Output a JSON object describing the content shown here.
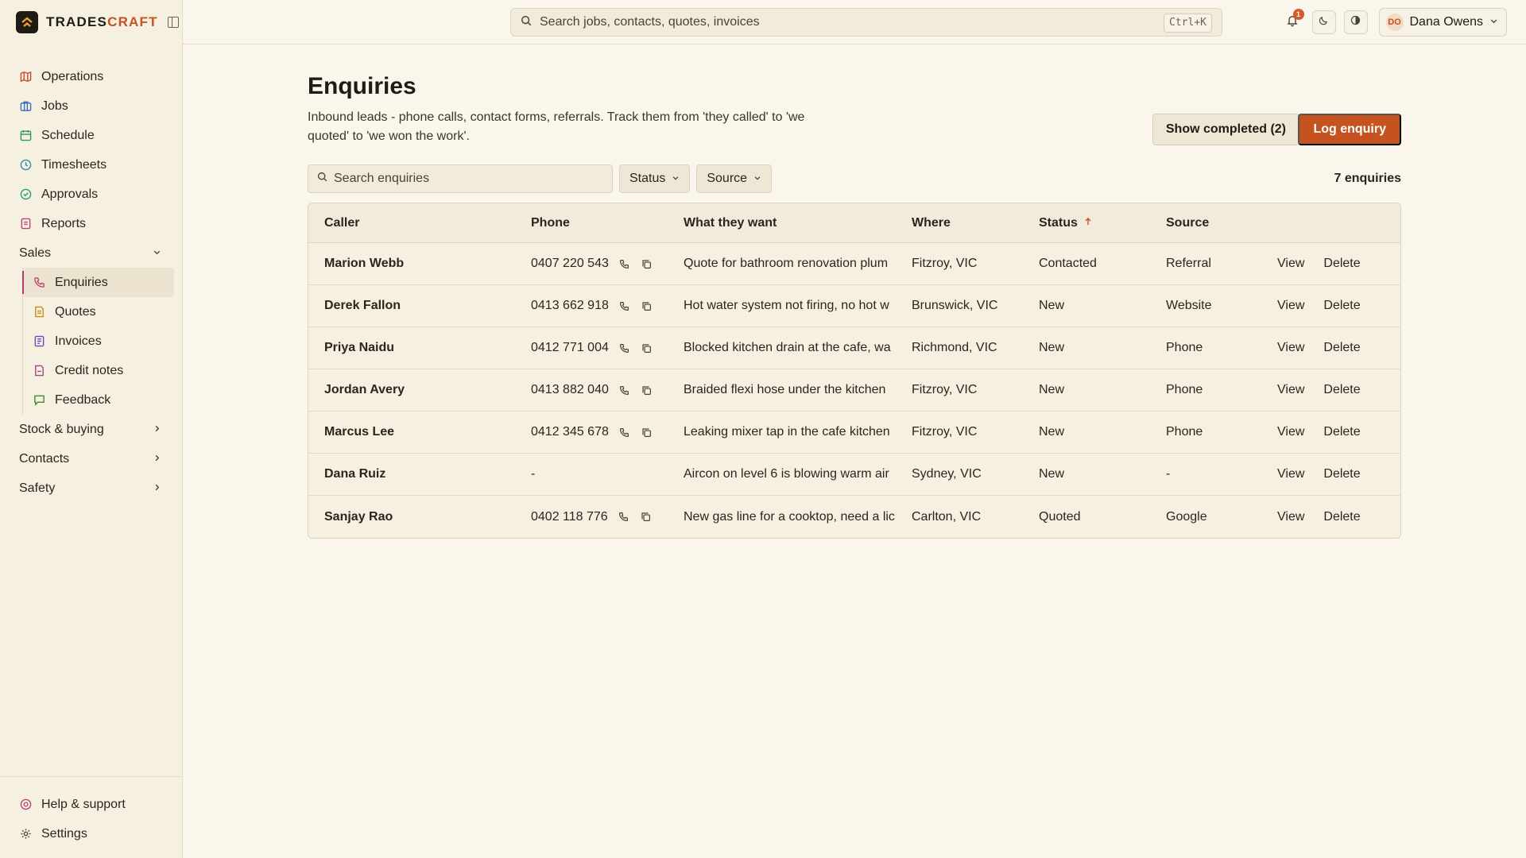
{
  "brand": {
    "name_main": "TRADES",
    "name_accent": "CRAFT"
  },
  "sidebar": {
    "items": [
      {
        "label": "Operations",
        "icon": "map-icon",
        "color": "#d0473a"
      },
      {
        "label": "Jobs",
        "icon": "briefcase-icon",
        "color": "#3b6fc4"
      },
      {
        "label": "Schedule",
        "icon": "calendar-icon",
        "color": "#2e9a52"
      },
      {
        "label": "Timesheets",
        "icon": "clock-icon",
        "color": "#2d8fa8"
      },
      {
        "label": "Approvals",
        "icon": "check-circle-icon",
        "color": "#2e9a7a"
      },
      {
        "label": "Reports",
        "icon": "report-icon",
        "color": "#b8467a"
      }
    ],
    "sales_group": "Sales",
    "sales_items": [
      {
        "label": "Enquiries",
        "icon": "phone-icon",
        "color": "#b83a6b"
      },
      {
        "label": "Quotes",
        "icon": "quote-icon",
        "color": "#c98a1a"
      },
      {
        "label": "Invoices",
        "icon": "invoice-icon",
        "color": "#6a4bc4"
      },
      {
        "label": "Credit notes",
        "icon": "credit-note-icon",
        "color": "#a0468a"
      },
      {
        "label": "Feedback",
        "icon": "message-icon",
        "color": "#3c8a3a"
      }
    ],
    "groups": [
      "Stock & buying",
      "Contacts",
      "Safety"
    ],
    "bottom": [
      {
        "label": "Help & support",
        "icon": "help-icon",
        "color": "#b8467a"
      },
      {
        "label": "Settings",
        "icon": "gear-icon",
        "color": "#4a4238"
      }
    ]
  },
  "topbar": {
    "search_placeholder": "Search jobs, contacts, quotes, invoices",
    "shortcut": "Ctrl+K",
    "notifications": "1",
    "user_initials": "DO",
    "user_name": "Dana Owens"
  },
  "page": {
    "title": "Enquiries",
    "description": "Inbound leads - phone calls, contact forms, referrals. Track them from 'they called' to 'we quoted' to 'we won the work'.",
    "show_completed": "Show completed (2)",
    "log_enquiry": "Log enquiry",
    "search_placeholder": "Search enquiries",
    "filter_status": "Status",
    "filter_source": "Source",
    "count": "7 enquiries"
  },
  "table": {
    "headers": {
      "caller": "Caller",
      "phone": "Phone",
      "want": "What they want",
      "where": "Where",
      "status": "Status",
      "source": "Source"
    },
    "view_label": "View",
    "delete_label": "Delete",
    "rows": [
      {
        "caller": "Marion Webb",
        "phone": "0407 220 543",
        "want": "Quote for bathroom renovation plum",
        "where": "Fitzroy, VIC",
        "status": "Contacted",
        "source": "Referral"
      },
      {
        "caller": "Derek Fallon",
        "phone": "0413 662 918",
        "want": "Hot water system not firing, no hot w",
        "where": "Brunswick, VIC",
        "status": "New",
        "source": "Website"
      },
      {
        "caller": "Priya Naidu",
        "phone": "0412 771 004",
        "want": "Blocked kitchen drain at the cafe, wa",
        "where": "Richmond, VIC",
        "status": "New",
        "source": "Phone"
      },
      {
        "caller": "Jordan Avery",
        "phone": "0413 882 040",
        "want": "Braided flexi hose under the kitchen",
        "where": "Fitzroy, VIC",
        "status": "New",
        "source": "Phone"
      },
      {
        "caller": "Marcus Lee",
        "phone": "0412 345 678",
        "want": "Leaking mixer tap in the cafe kitchen",
        "where": "Fitzroy, VIC",
        "status": "New",
        "source": "Phone"
      },
      {
        "caller": "Dana Ruiz",
        "phone": "-",
        "want": "Aircon on level 6 is blowing warm air",
        "where": "Sydney, VIC",
        "status": "New",
        "source": "-"
      },
      {
        "caller": "Sanjay Rao",
        "phone": "0402 118 776",
        "want": "New gas line for a cooktop, need a lic",
        "where": "Carlton, VIC",
        "status": "Quoted",
        "source": "Google"
      }
    ]
  }
}
